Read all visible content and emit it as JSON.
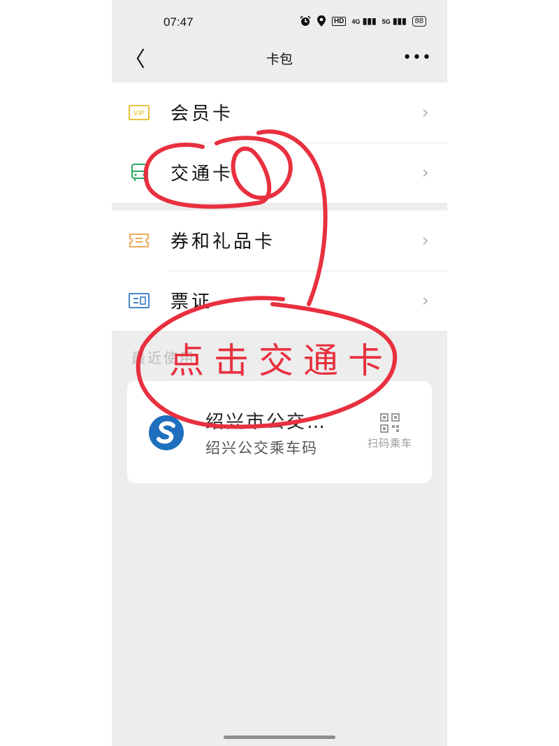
{
  "status_bar": {
    "time": "07:47",
    "icons": [
      "alarm-icon",
      "location-icon",
      "hd-icon",
      "4g-signal-icon",
      "5g-signal-icon"
    ],
    "hd": "HD",
    "net1": "4G",
    "net2": "5G",
    "battery": "88"
  },
  "nav": {
    "back_glyph": "〈",
    "title": "卡包",
    "more_glyph": "•••"
  },
  "menu": {
    "items": [
      {
        "label": "会员卡",
        "icon": "vip-card-icon"
      },
      {
        "label": "交通卡",
        "icon": "bus-icon"
      },
      {
        "label": "券和礼品卡",
        "icon": "ticket-icon"
      },
      {
        "label": "票证",
        "icon": "id-card-icon"
      }
    ],
    "chevron": "›"
  },
  "recent": {
    "label": "最近使用",
    "card": {
      "title": "绍兴市公交…",
      "subtitle": "绍兴公交乘车码",
      "action_label": "扫码乘车"
    }
  },
  "annotation": {
    "text": "点击交通卡"
  },
  "colors": {
    "vip": "#e5b924",
    "bus": "#2aa862",
    "ticket": "#e8a24a",
    "id_card": "#2f78c4",
    "annotation": "#e8303f",
    "logo": "#1f6fbf"
  }
}
